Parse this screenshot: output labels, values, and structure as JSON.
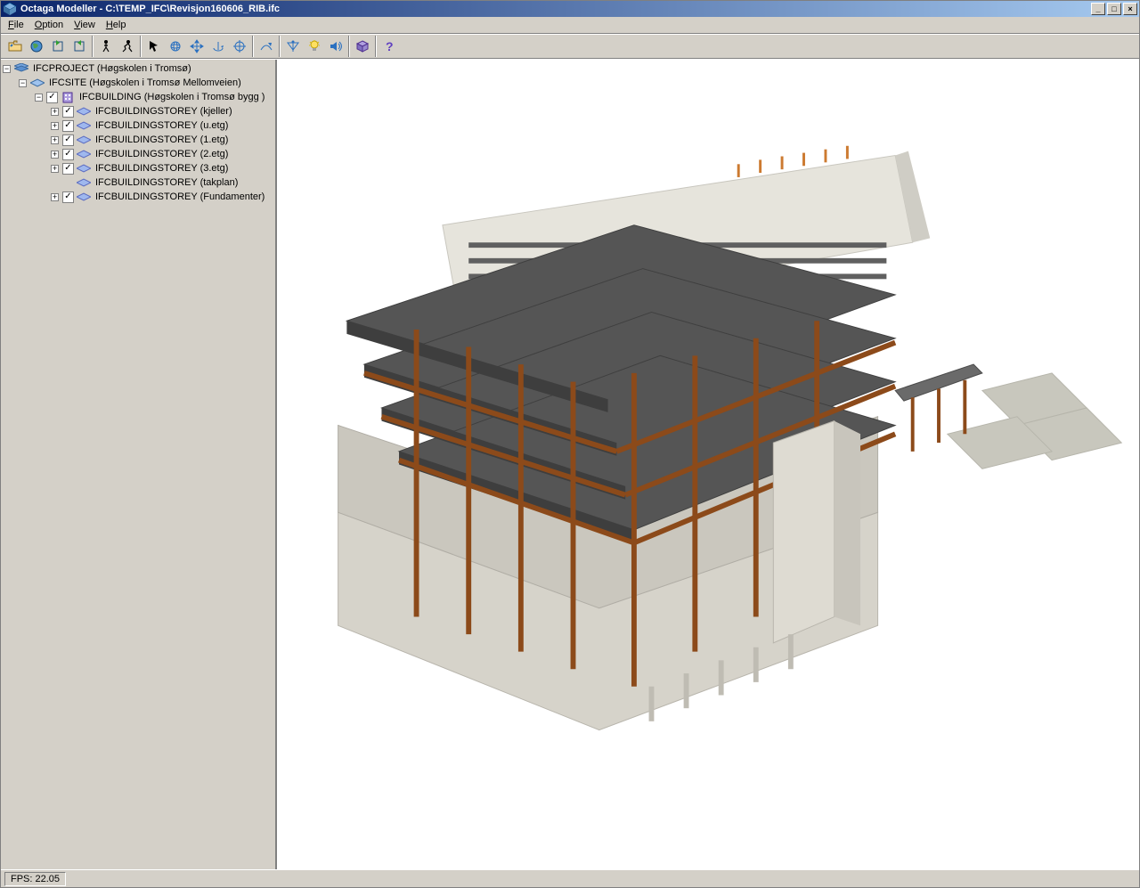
{
  "titlebar": {
    "app_name": "Octaga Modeller",
    "document_path": "C:\\TEMP_IFC\\Revisjon160606_RIB.ifc",
    "full_title": "Octaga Modeller - C:\\TEMP_IFC\\Revisjon160606_RIB.ifc"
  },
  "menus": {
    "file": "File",
    "option": "Option",
    "view": "View",
    "help": "Help"
  },
  "toolbar": {
    "buttons": [
      "open-folder",
      "world",
      "refresh",
      "reload",
      "walk-person",
      "run-person",
      "arrow-pointer",
      "rotate-globe",
      "pan-move",
      "rotate-axis",
      "target-crosshair",
      "goto-view",
      "anchor-down",
      "light-bulb",
      "sound-speaker",
      "cube-3d",
      "help-question"
    ],
    "separators_after": [
      3,
      5,
      10,
      11,
      14,
      15
    ]
  },
  "tree": {
    "root": {
      "label": "IFCPROJECT (Høgskolen i Tromsø)",
      "icon": "project-icon",
      "children": [
        {
          "label": "IFCSITE (Høgskolen i Tromsø Mellomveien)",
          "icon": "site-icon",
          "children": [
            {
              "label": "IFCBUILDING (Høgskolen i Tromsø bygg )",
              "icon": "building-icon",
              "checked": true,
              "children": [
                {
                  "label": "IFCBUILDINGSTOREY (kjeller)",
                  "icon": "storey-icon",
                  "checked": true,
                  "expandable": true
                },
                {
                  "label": "IFCBUILDINGSTOREY (u.etg)",
                  "icon": "storey-icon",
                  "checked": true,
                  "expandable": true
                },
                {
                  "label": "IFCBUILDINGSTOREY (1.etg)",
                  "icon": "storey-icon",
                  "checked": true,
                  "expandable": true
                },
                {
                  "label": "IFCBUILDINGSTOREY (2.etg)",
                  "icon": "storey-icon",
                  "checked": true,
                  "expandable": true
                },
                {
                  "label": "IFCBUILDINGSTOREY (3.etg)",
                  "icon": "storey-icon",
                  "checked": true,
                  "expandable": true
                },
                {
                  "label": "IFCBUILDINGSTOREY (takplan)",
                  "icon": "storey-icon",
                  "checked": false,
                  "nocheckbox": true
                },
                {
                  "label": "IFCBUILDINGSTOREY (Fundamenter)",
                  "icon": "storey-icon",
                  "checked": true,
                  "expandable": true
                }
              ]
            }
          ]
        }
      ]
    }
  },
  "status": {
    "fps_label": "FPS: 22.05"
  },
  "viewport": {
    "description": "3D isometric view of a multi-storey concrete and steel building structure",
    "colors": {
      "slab": "#555555",
      "beam": "#8c4a1a",
      "wall": "#d9d6cf",
      "shadow": "#3a3a3a",
      "ground": "#c8c8bd"
    }
  }
}
